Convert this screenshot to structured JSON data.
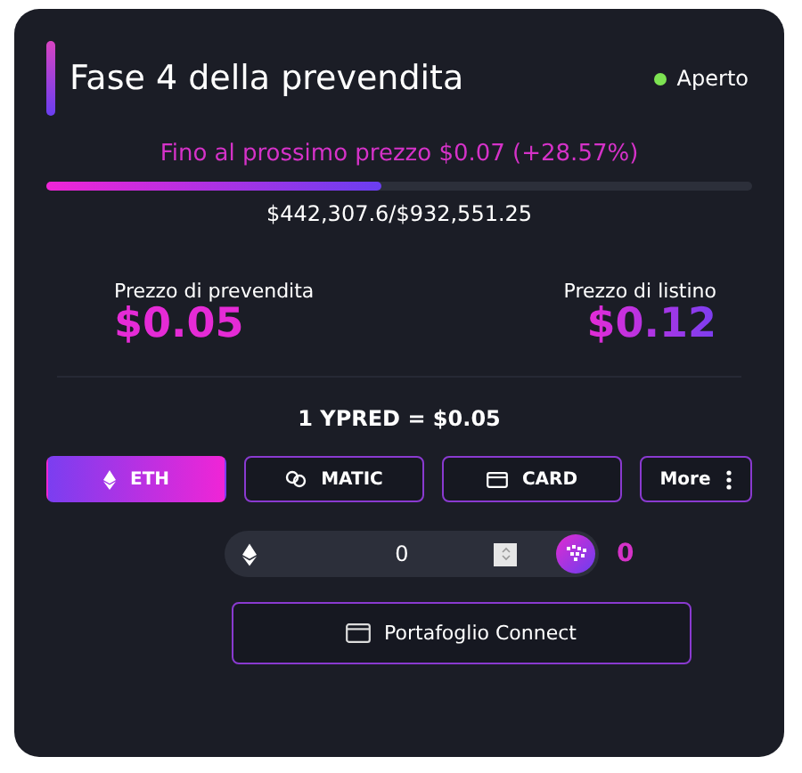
{
  "title": "Fase 4 della prevendita",
  "status": {
    "label": "Aperto",
    "color": "#7de352"
  },
  "next_price": "Fino al prossimo prezzo $0.07 (+28.57%)",
  "progress": {
    "level": 0.474,
    "reading": "$442,307.6/$932,551.25"
  },
  "prices": [
    {
      "label": "Prezzo di prevendita",
      "value": "$0.05"
    },
    {
      "label": "Prezzo di listino",
      "value": "$0.12"
    }
  ],
  "rate": "1 YPRED = $0.05",
  "payment_tabs": [
    {
      "label": "ETH",
      "kind": "eth",
      "selected": true
    },
    {
      "label": "MATIC",
      "kind": "link",
      "selected": false
    },
    {
      "label": "CARD",
      "kind": "card",
      "selected": false
    },
    {
      "label": "More",
      "kind": "more",
      "selected": false
    }
  ],
  "amount": {
    "value": "0",
    "receive": "0"
  },
  "connect_button": "Portafoglio Connect"
}
